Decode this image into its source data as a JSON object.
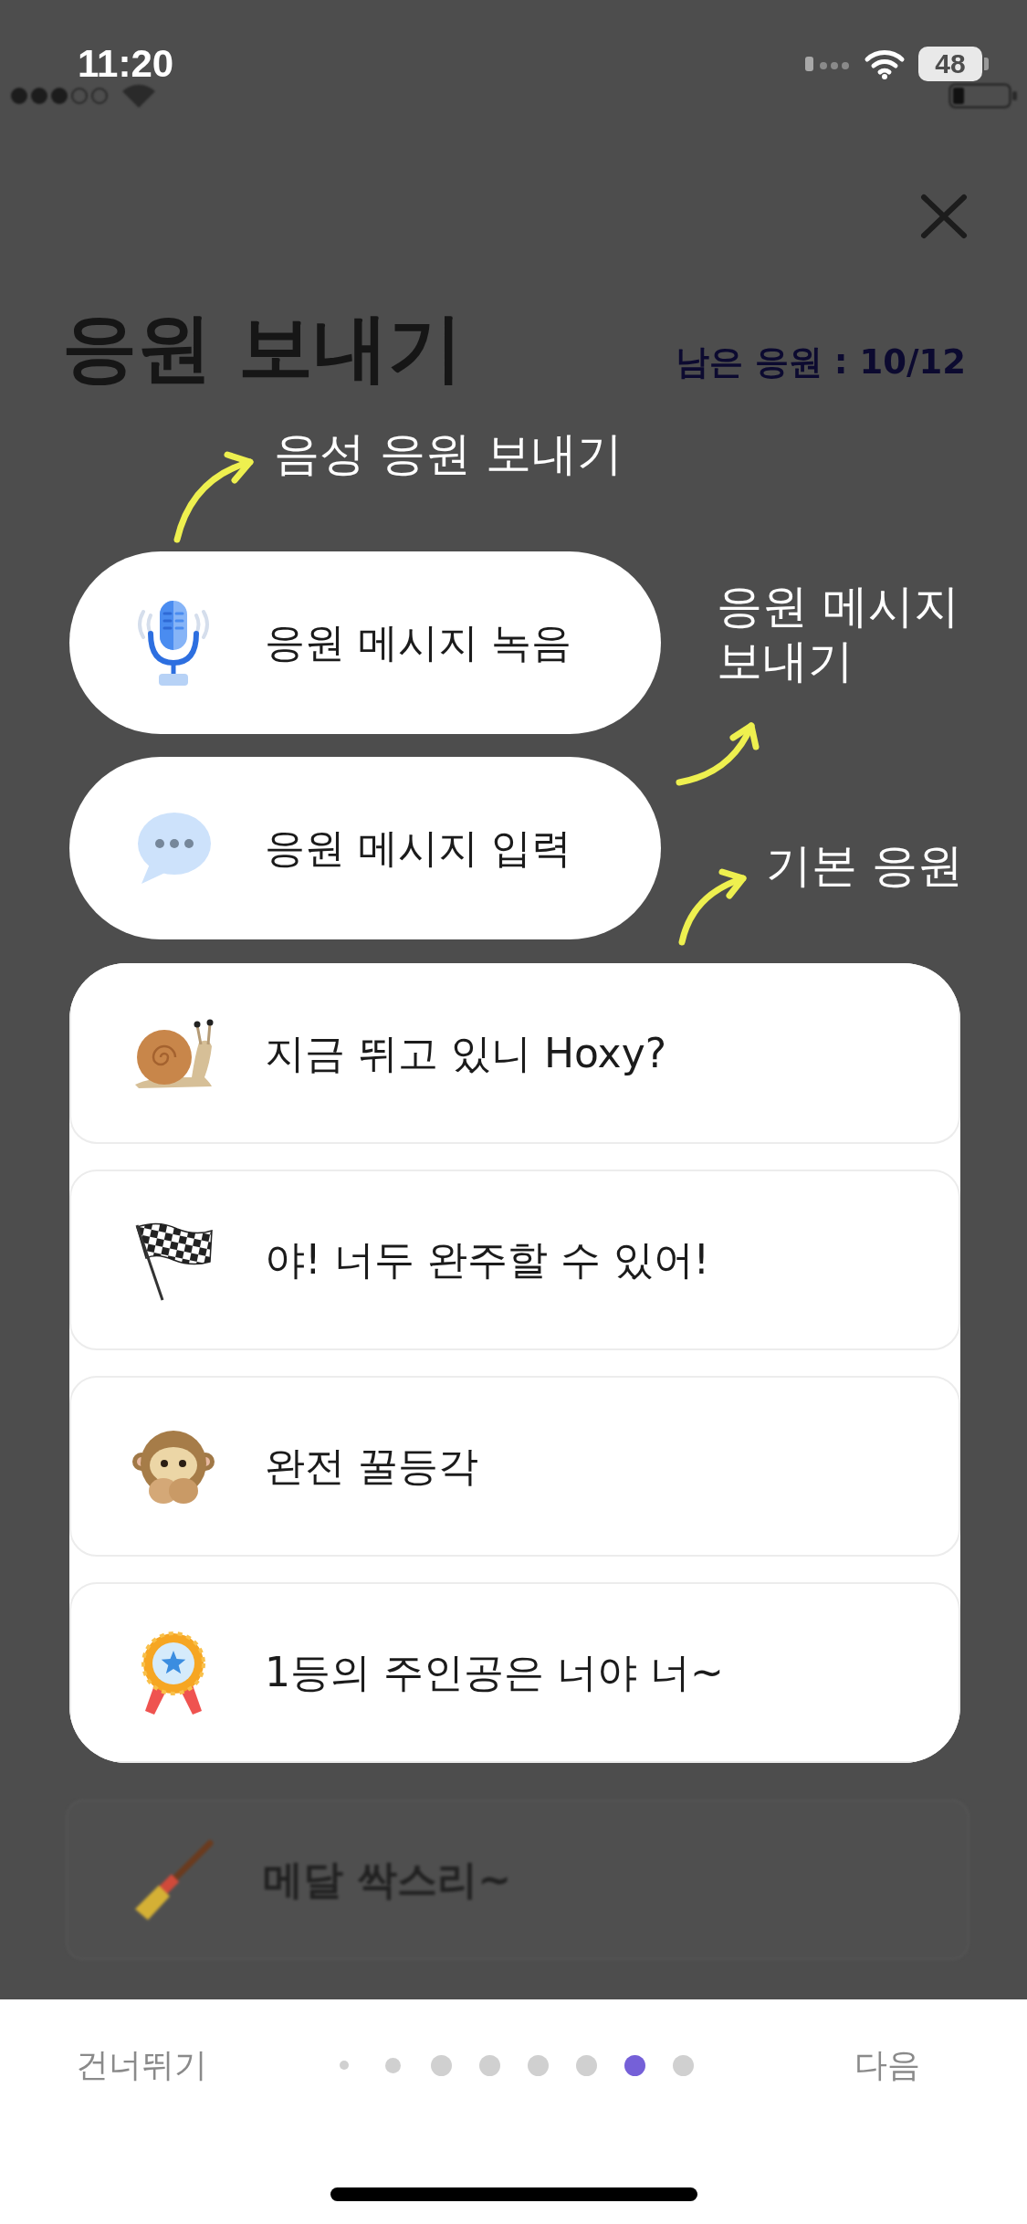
{
  "status_bar": {
    "time": "11:20",
    "battery": "48"
  },
  "header": {
    "title": "응원 보내기",
    "remaining": "남은 응원 : 10/12"
  },
  "coach_marks": {
    "voice": "음성 응원 보내기",
    "message": "응원 메시지 보내기",
    "basic": "기본 응원"
  },
  "message_options": [
    {
      "label": "응원 메시지 녹음"
    },
    {
      "label": "응원 메시지 입력"
    }
  ],
  "cheers": [
    {
      "label": "지금 뛰고 있니 Hoxy?",
      "highlighted": true
    },
    {
      "label": "야! 너두 완주할 수 있어!",
      "highlighted": true
    },
    {
      "label": "완전 꿀등각",
      "highlighted": true
    },
    {
      "label": "1등의 주인공은 너야 너~",
      "highlighted": true
    },
    {
      "label": "메달 싹스리~",
      "highlighted": false
    }
  ],
  "footer": {
    "skip": "건너뛰기",
    "next": "다음",
    "pages": [
      {
        "kind": "tiny",
        "selected": false
      },
      {
        "kind": "small",
        "selected": false
      },
      {
        "kind": "regular",
        "selected": false
      },
      {
        "kind": "regular",
        "selected": false
      },
      {
        "kind": "regular",
        "selected": false
      },
      {
        "kind": "regular",
        "selected": false
      },
      {
        "kind": "regular",
        "selected": true
      },
      {
        "kind": "regular",
        "selected": false
      }
    ]
  }
}
